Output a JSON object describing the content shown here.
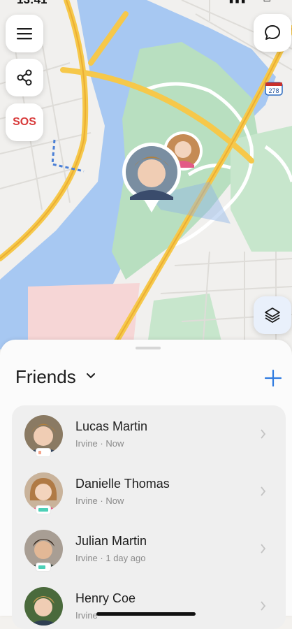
{
  "status": {
    "time": "13:41",
    "icons": "▮▮▮ ◠ ▭"
  },
  "map": {
    "buttons": {
      "sos_label": "SOS"
    },
    "highway_shield": "278",
    "colors": {
      "water": "#a7c8f2",
      "park": "#b8dfc0",
      "road": "#f6c84a",
      "land": "#f1f0ee"
    }
  },
  "sheet": {
    "title": "Friends",
    "friends": [
      {
        "name": "Lucas Martin",
        "location": "Irvine",
        "time": "Now",
        "battery_color": "#f4a58b",
        "battery": 0.3
      },
      {
        "name": "Danielle Thomas",
        "location": "Irvine",
        "time": "Now",
        "battery_color": "#4dd0b7",
        "battery": 1.0
      },
      {
        "name": "Julian Martin",
        "location": "Irvine",
        "time": "1 day ago",
        "battery_color": "#4dd0b7",
        "battery": 0.7
      },
      {
        "name": "Henry Coe",
        "location": "Irvine",
        "time": "",
        "battery_color": "#4dd0b7",
        "battery": 0.7
      }
    ]
  }
}
